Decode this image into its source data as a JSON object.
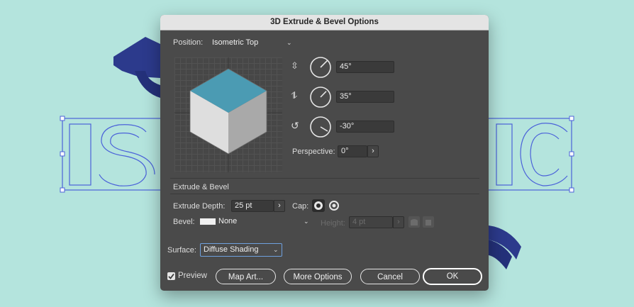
{
  "dialog": {
    "title": "3D Extrude & Bevel Options",
    "position": {
      "label": "Position:",
      "value": "Isometric Top"
    },
    "rotation": {
      "x_value": "45°",
      "y_value": "35°",
      "z_value": "-30°",
      "x_icon": "rotate-x-axis-icon",
      "y_icon": "rotate-y-axis-icon",
      "z_icon": "rotate-z-axis-icon"
    },
    "perspective": {
      "label": "Perspective:",
      "value": "0°"
    },
    "extrude_bevel": {
      "section_title": "Extrude & Bevel",
      "depth_label": "Extrude Depth:",
      "depth_value": "25 pt",
      "cap_label": "Cap:",
      "bevel_label": "Bevel:",
      "bevel_value": "None",
      "height_label": "Height:",
      "height_value": "4 pt"
    },
    "surface": {
      "label": "Surface:",
      "value": "Diffuse Shading"
    },
    "footer": {
      "preview_label": "Preview",
      "preview_checked": true,
      "map_art_label": "Map Art...",
      "more_options_label": "More Options",
      "cancel_label": "Cancel",
      "ok_label": "OK"
    },
    "cube_colors": {
      "top": "#4b9bb3",
      "left": "#dedede",
      "right": "#a9a9a9"
    }
  },
  "background": {
    "colors": {
      "bg": "#b4e4dd",
      "outline": "#4b62d9",
      "navy": "#2c3a8c"
    }
  }
}
